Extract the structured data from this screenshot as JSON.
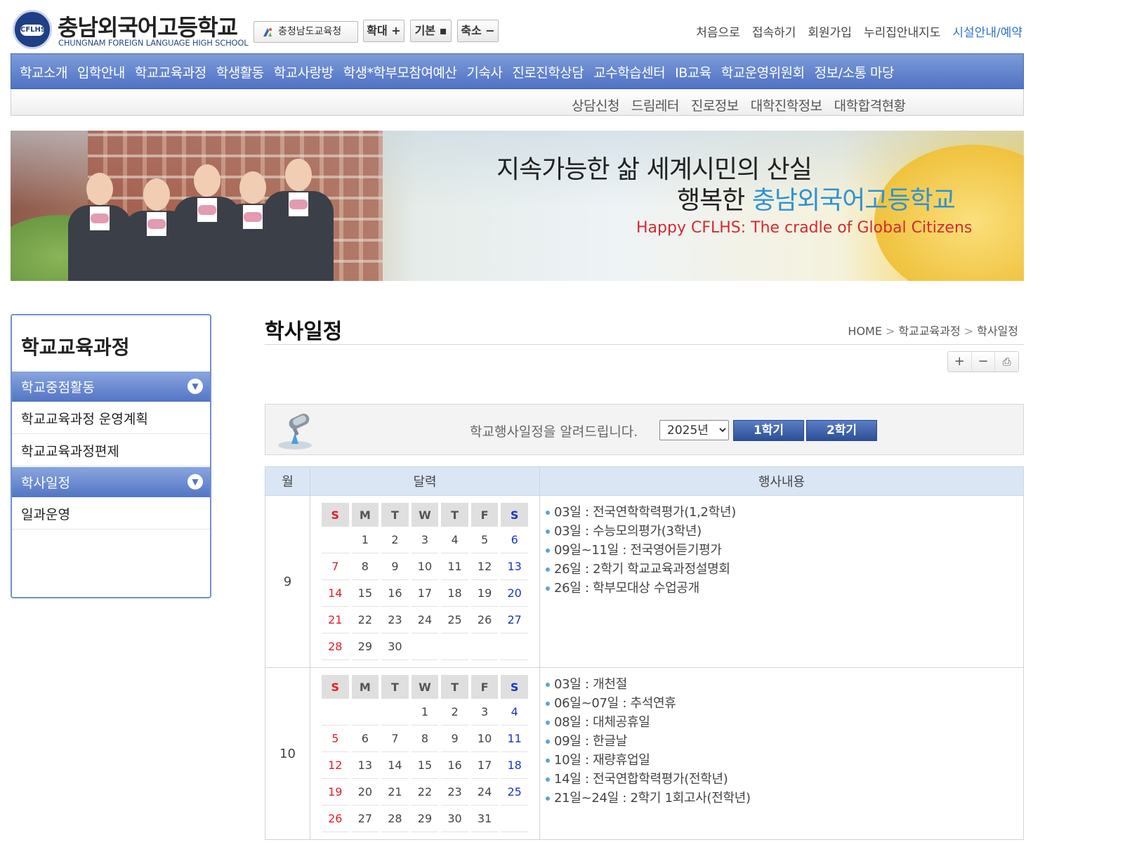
{
  "header": {
    "logo_emblem": "CFLHS",
    "school_name_kr": "충남외국어고등학교",
    "school_name_en": "CHUNGNAM FOREIGN LANGUAGE HIGH SCHOOL",
    "edu_office": "충청남도교육청",
    "zoom_in": "확대 +",
    "zoom_reset": "기본 ▪",
    "zoom_out": "축소 −",
    "top_links": [
      "처음으로",
      "접속하기",
      "회원가입",
      "누리집안내지도",
      "시설안내/예약"
    ]
  },
  "gnb": {
    "items": [
      "학교소개",
      "입학안내",
      "학교교육과정",
      "학생활동",
      "학교사랑방",
      "학생*학부모참여예산",
      "기숙사",
      "진로진학상담",
      "교수학습센터",
      "IB교육",
      "학교운영위원회",
      "정보/소통 마당"
    ],
    "sub_items": [
      "상담신청",
      "드림레터",
      "진로정보",
      "대학진학정보",
      "대학합격현황"
    ]
  },
  "banner": {
    "line1": "지속가능한 삶 세계시민의 산실",
    "line2_prefix": "행복한 ",
    "line2_highlight": "충남외국어고등학교",
    "line3": "Happy CFLHS: The cradle of Global Citizens"
  },
  "sidebar": {
    "title": "학교교육과정",
    "head1": "학교중점활동",
    "items1": [
      "학교교육과정 운영계획",
      "학교교육과정편제"
    ],
    "head2": "학사일정",
    "items2": [
      "일과운영"
    ]
  },
  "content": {
    "title": "학사일정",
    "breadcrumb": [
      "HOME",
      "학교교육과정",
      "학사일정"
    ],
    "tools": [
      "+",
      "−",
      "⎙"
    ],
    "schedule_msg": "학교행사일정을 알려드립니다.",
    "year_selected": "2025년",
    "sem1": "1학기",
    "sem2": "2학기"
  },
  "table": {
    "headers": [
      "월",
      "달력",
      "행사내용"
    ],
    "weekdays": [
      "S",
      "M",
      "T",
      "W",
      "T",
      "F",
      "S"
    ],
    "months": [
      {
        "month": "9",
        "weeks": [
          [
            "",
            "1",
            "2",
            "3",
            "4",
            "5",
            "6"
          ],
          [
            "7",
            "8",
            "9",
            "10",
            "11",
            "12",
            "13"
          ],
          [
            "14",
            "15",
            "16",
            "17",
            "18",
            "19",
            "20"
          ],
          [
            "21",
            "22",
            "23",
            "24",
            "25",
            "26",
            "27"
          ],
          [
            "28",
            "29",
            "30",
            "",
            "",
            "",
            ""
          ]
        ],
        "events": [
          "03일 : 전국연학학력평가(1,2학년)",
          "03일 : 수능모의평가(3학년)",
          "09일~11일 : 전국영어듣기평가",
          "26일 : 2학기 학교교육과정설명회",
          "26일 : 학부모대상 수업공개"
        ]
      },
      {
        "month": "10",
        "weeks": [
          [
            "",
            "",
            "",
            "1",
            "2",
            "3",
            "4"
          ],
          [
            "5",
            "6",
            "7",
            "8",
            "9",
            "10",
            "11"
          ],
          [
            "12",
            "13",
            "14",
            "15",
            "16",
            "17",
            "18"
          ],
          [
            "19",
            "20",
            "21",
            "22",
            "23",
            "24",
            "25"
          ],
          [
            "26",
            "27",
            "28",
            "29",
            "30",
            "31",
            ""
          ]
        ],
        "events": [
          "03일 : 개천절",
          "06일~07일 : 추석연휴",
          "08일 : 대체공휴일",
          "09일 : 한글날",
          "10일 : 재량휴업일",
          "14일 : 전국연합학력평가(전학년)",
          "21일~24일 : 2학기 1회고사(전학년)"
        ]
      }
    ]
  },
  "colors": {
    "nav_blue": "#5a7dc8",
    "sunday": "#e21e2c",
    "saturday": "#1c34c9",
    "active_link": "#2c72d4",
    "banner_highlight": "#2f92d4",
    "banner_tagline": "#d32a32"
  }
}
